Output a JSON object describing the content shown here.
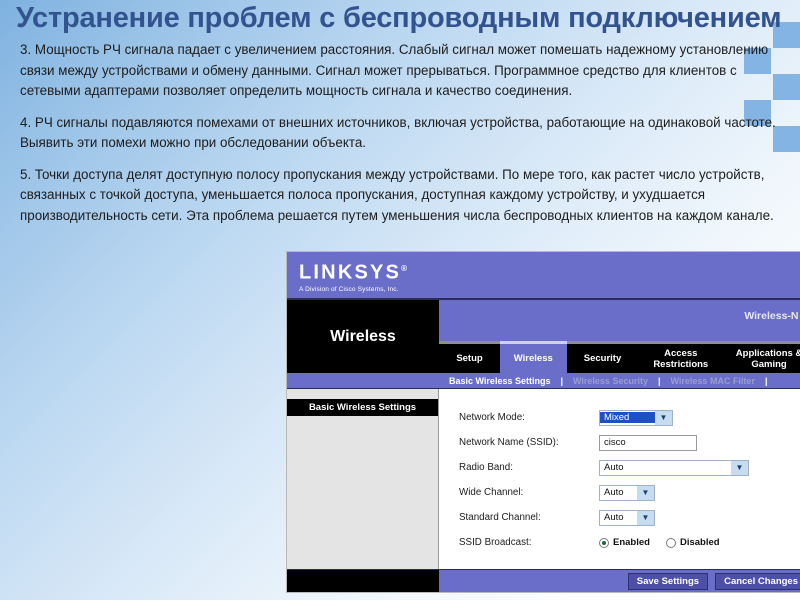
{
  "slide": {
    "title": "Устранение проблем с беспроводным подключением",
    "paragraphs": [
      "3. Мощность РЧ сигнала падает с увеличением расстояния. Слабый сигнал может помешать надежному установлению связи между устройствами и обмену данными. Сигнал может прерываться. Программное средство для клиентов с сетевыми адаптерами позволяет определить мощность сигнала и качество соединения.",
      "4. РЧ сигналы подавляются помехами от внешних источников, включая устройства, работающие на одинаковой частоте. Выявить эти помехи можно при обследовании объекта.",
      "5. Точки доступа делят доступную полосу пропускания между устройствами. По мере того, как растет число устройств, связанных с точкой доступа, уменьшается полоса пропускания, доступная каждому устройству, и ухудшается производительность сети. Эта проблема решается путем уменьшения числа беспроводных клиентов на каждом канале."
    ],
    "colors": {
      "title_text": "#33538e",
      "background_start": "#7fb2e0",
      "background_end": "#ffffff",
      "decor_square": "#83b4e3"
    }
  },
  "router": {
    "brand": {
      "name": "LINKSYS",
      "trademark": "®",
      "tagline": "A Division of Cisco Systems, Inc."
    },
    "model": "Wireless-N B",
    "section_title": "Wireless",
    "tabs": [
      {
        "label": "Setup",
        "active": false
      },
      {
        "label": "Wireless",
        "active": true
      },
      {
        "label": "Security",
        "active": false
      },
      {
        "label": "Access Restrictions",
        "active": false
      },
      {
        "label": "Applications & Gaming",
        "active": false
      }
    ],
    "subtabs": [
      {
        "label": "Basic Wireless Settings",
        "active": true
      },
      {
        "label": "Wireless Security",
        "active": false
      },
      {
        "label": "Wireless MAC Filter",
        "active": false
      }
    ],
    "subtab_separator": "|",
    "sidebar_heading": "Basic Wireless Settings",
    "form": {
      "network_mode": {
        "label": "Network Mode:",
        "value": "Mixed"
      },
      "ssid": {
        "label": "Network Name (SSID):",
        "value": "cisco"
      },
      "radio_band": {
        "label": "Radio Band:",
        "value": "Auto"
      },
      "wide_channel": {
        "label": "Wide Channel:",
        "value": "Auto"
      },
      "standard_channel": {
        "label": "Standard Channel:",
        "value": "Auto"
      },
      "ssid_broadcast": {
        "label": "SSID Broadcast:",
        "enabled_label": "Enabled",
        "disabled_label": "Disabled",
        "selected": "Enabled"
      }
    },
    "buttons": {
      "save": "Save Settings",
      "cancel": "Cancel Changes"
    },
    "icons": {
      "dropdown_arrow": "▼"
    },
    "colors": {
      "chrome_purple": "#6b6ec9",
      "tab_black": "#000000",
      "selection_blue": "#1f4fc4",
      "button_purple": "#4e4fa6"
    }
  }
}
